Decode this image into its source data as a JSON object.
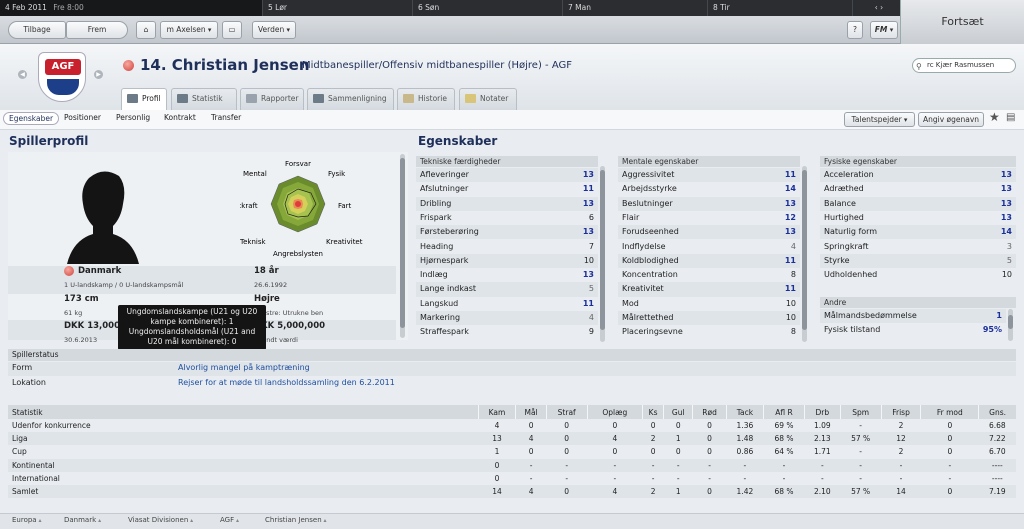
{
  "topbar": {
    "date": "4 Feb 2011",
    "time": "Fre 8:00",
    "days": [
      "5 Lør",
      "6 Søn",
      "7 Man",
      "8 Tir"
    ],
    "continue_label": "Fortsæt"
  },
  "nav": {
    "back": "Tilbage",
    "forward": "Frem",
    "manager": "m Axelsen",
    "world": "Verden",
    "help": "?",
    "fm": "FM"
  },
  "player": {
    "club_logo_text": "AGF",
    "number_name": "14. Christian Jensen",
    "position": "Midtbanespiller/Offensiv midtbanespiller (Højre) - AGF"
  },
  "search": {
    "value": "rc Kjær Rasmussen"
  },
  "tabs": [
    "Profil",
    "Statistik",
    "Rapporter",
    "Sammenligning",
    "Historie",
    "Notater"
  ],
  "subtabs": [
    "Egenskaber",
    "Positioner",
    "Personlig",
    "Kontrakt",
    "Transfer"
  ],
  "actions": {
    "scout": "Talentspejder",
    "offer": "Angiv øgenavn"
  },
  "profile": {
    "title": "Spillerprofil",
    "nation": "Danmark",
    "caps": "1 U-landskamp / 0 U-landskampsmål",
    "age": "18 år",
    "dob": "26.6.1992",
    "height": "173 cm",
    "weight": "61 kg",
    "foot": "Højre",
    "foot_sub": "Venstre: Utrukne ben",
    "value": "DKK 13,000",
    "wage": "DKK 5,000,000",
    "contract": "30.6.2013",
    "contract2": "Ukendt værdi"
  },
  "radar": {
    "labels": [
      "Forsvar",
      "Fysik",
      "Fart",
      "Kreativitet",
      "Angrebslysten",
      "Teknisk",
      "Luftkraft",
      "Mental"
    ]
  },
  "tooltip": {
    "line1": "Ungdomslandskampe (U21 og U20",
    "line2": "kampe kombineret): 1",
    "line3": "Ungdomslandsholdsmål (U21 and",
    "line4": "U20 mål kombineret): 0"
  },
  "attributes": {
    "title": "Egenskaber",
    "technical": {
      "header": "Tekniske færdigheder",
      "items": [
        {
          "name": "Afleveringer",
          "value": "13",
          "hi": true
        },
        {
          "name": "Afslutninger",
          "value": "11",
          "hi": true
        },
        {
          "name": "Dribling",
          "value": "13",
          "hi": true
        },
        {
          "name": "Frispark",
          "value": "6",
          "hi": false
        },
        {
          "name": "Førsteberøring",
          "value": "13",
          "hi": true
        },
        {
          "name": "Heading",
          "value": "7",
          "hi": false
        },
        {
          "name": "Hjørnespark",
          "value": "10",
          "hi": false
        },
        {
          "name": "Indlæg",
          "value": "13",
          "hi": true
        },
        {
          "name": "Lange indkast",
          "value": "5",
          "hi": false,
          "lo": true
        },
        {
          "name": "Langskud",
          "value": "11",
          "hi": true
        },
        {
          "name": "Markering",
          "value": "4",
          "hi": false,
          "lo": true
        },
        {
          "name": "Straffespark",
          "value": "9",
          "hi": false
        }
      ]
    },
    "mental": {
      "header": "Mentale egenskaber",
      "items": [
        {
          "name": "Aggressivitet",
          "value": "11",
          "hi": true
        },
        {
          "name": "Arbejdsstyrke",
          "value": "14",
          "hi": true
        },
        {
          "name": "Beslutninger",
          "value": "13",
          "hi": true
        },
        {
          "name": "Flair",
          "value": "12",
          "hi": true
        },
        {
          "name": "Forudseenhed",
          "value": "13",
          "hi": true
        },
        {
          "name": "Indflydelse",
          "value": "4",
          "hi": false,
          "lo": true
        },
        {
          "name": "Koldblodighed",
          "value": "11",
          "hi": true
        },
        {
          "name": "Koncentration",
          "value": "8",
          "hi": false
        },
        {
          "name": "Kreativitet",
          "value": "11",
          "hi": true
        },
        {
          "name": "Mod",
          "value": "10",
          "hi": false
        },
        {
          "name": "Målrettethed",
          "value": "10",
          "hi": false
        },
        {
          "name": "Placeringsevne",
          "value": "8",
          "hi": false
        }
      ]
    },
    "physical": {
      "header": "Fysiske egenskaber",
      "items": [
        {
          "name": "Acceleration",
          "value": "13",
          "hi": true
        },
        {
          "name": "Adræthed",
          "value": "13",
          "hi": true
        },
        {
          "name": "Balance",
          "value": "13",
          "hi": true
        },
        {
          "name": "Hurtighed",
          "value": "13",
          "hi": true
        },
        {
          "name": "Naturlig form",
          "value": "14",
          "hi": true
        },
        {
          "name": "Springkraft",
          "value": "3",
          "hi": false,
          "lo": true
        },
        {
          "name": "Styrke",
          "value": "5",
          "hi": false,
          "lo": true
        },
        {
          "name": "Udholdenhed",
          "value": "10",
          "hi": false
        }
      ]
    },
    "other": {
      "header": "Andre",
      "items": [
        {
          "name": "Målmandsbedømmelse",
          "value": "1",
          "hi": true
        },
        {
          "name": "Fysisk tilstand",
          "value": "95%",
          "hi": true
        }
      ]
    }
  },
  "status": {
    "header": "Spillerstatus",
    "rows": [
      {
        "key": "Form",
        "value": "Alvorlig mangel på kamptræning"
      },
      {
        "key": "Lokation",
        "value": "Rejser for at møde til landsholdssamling den 6.2.2011"
      }
    ]
  },
  "stats": {
    "columns": [
      "Statistik",
      "Kam",
      "Mål",
      "Straf",
      "Oplæg",
      "Ks",
      "Gul",
      "Rød",
      "Tack",
      "Afl R",
      "Drb",
      "Spm",
      "Frisp",
      "Fr mod",
      "Gns."
    ],
    "rows": [
      [
        "Udenfor konkurrence",
        "4",
        "0",
        "0",
        "0",
        "0",
        "0",
        "0",
        "1.36",
        "69 %",
        "1.09",
        "-",
        "2",
        "0",
        "6.68"
      ],
      [
        "Liga",
        "13",
        "4",
        "0",
        "4",
        "2",
        "1",
        "0",
        "1.48",
        "68 %",
        "2.13",
        "57 %",
        "12",
        "0",
        "7.22"
      ],
      [
        "Cup",
        "1",
        "0",
        "0",
        "0",
        "0",
        "0",
        "0",
        "0.86",
        "64 %",
        "1.71",
        "-",
        "2",
        "0",
        "6.70"
      ],
      [
        "Kontinental",
        "0",
        "-",
        "-",
        "-",
        "-",
        "-",
        "-",
        "-",
        "-",
        "-",
        "-",
        "-",
        "-",
        "----"
      ],
      [
        "International",
        "0",
        "-",
        "-",
        "-",
        "-",
        "-",
        "-",
        "-",
        "-",
        "-",
        "-",
        "-",
        "-",
        "----"
      ],
      [
        "Samlet",
        "14",
        "4",
        "0",
        "4",
        "2",
        "1",
        "0",
        "1.42",
        "68 %",
        "2.10",
        "57 %",
        "14",
        "0",
        "7.19"
      ]
    ]
  },
  "breadcrumbs": [
    "Europa",
    "Danmark",
    "Viasat Divisionen",
    "AGF",
    "Christian Jensen"
  ]
}
